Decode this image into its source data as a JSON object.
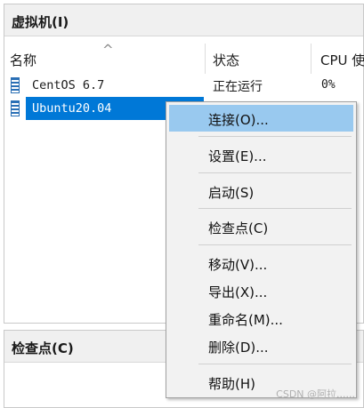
{
  "vm_panel": {
    "title": "虚拟机(I)",
    "columns": {
      "name": "名称",
      "status": "状态",
      "cpu": "CPU 使"
    },
    "rows": [
      {
        "name": "CentOS 6.7",
        "status": "正在运行",
        "cpu": "0%"
      },
      {
        "name": "Ubuntu20.04",
        "status": "",
        "cpu": ""
      }
    ]
  },
  "checkpoint_panel": {
    "title": "检查点(C)"
  },
  "context_menu": {
    "items": [
      {
        "label": "连接(O)..."
      },
      {
        "label": "设置(E)..."
      },
      {
        "label": "启动(S)"
      },
      {
        "label": "检查点(C)"
      },
      {
        "label": "移动(V)..."
      },
      {
        "label": "导出(X)..."
      },
      {
        "label": "重命名(M)..."
      },
      {
        "label": "删除(D)..."
      },
      {
        "label": "帮助(H)"
      }
    ]
  },
  "watermark": "CSDN @阿拉......",
  "colors": {
    "selection": "#0078d7",
    "menu_highlight": "#99c9ef",
    "menu_bg": "#f2f2f2"
  },
  "icons": {
    "vm": "vm-icon",
    "sort": "sort-caret-icon"
  }
}
